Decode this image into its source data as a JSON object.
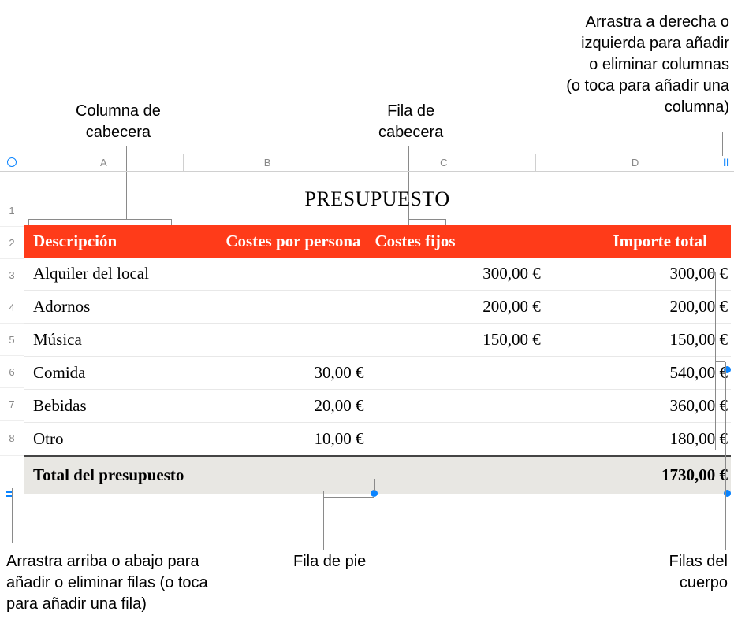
{
  "callouts": {
    "header_col": "Columna de\ncabecera",
    "header_row": "Fila de\ncabecera",
    "add_cols": "Arrastra a derecha o\nizquierda para añadir\no eliminar columnas\n(o toca para añadir una\ncolumna)",
    "add_rows": "Arrastra arriba o abajo para\nañadir o eliminar filas (o toca\npara añadir una fila)",
    "footer_row": "Fila de pie",
    "body_rows": "Filas del\ncuerpo"
  },
  "sheet": {
    "title": "PRESUPUESTO",
    "col_letters": [
      "A",
      "B",
      "C",
      "D"
    ],
    "row_nums": [
      "1",
      "2",
      "3",
      "4",
      "5",
      "6",
      "7",
      "8"
    ],
    "headers": {
      "c1": "Descripción",
      "c2": "Costes por persona",
      "c3": "Costes fijos",
      "c4": "Importe total"
    },
    "rows": [
      {
        "desc": "Alquiler del local",
        "per_person": "",
        "fixed": "300,00 €",
        "total": "300,00 €"
      },
      {
        "desc": "Adornos",
        "per_person": "",
        "fixed": "200,00 €",
        "total": "200,00 €"
      },
      {
        "desc": "Música",
        "per_person": "",
        "fixed": "150,00 €",
        "total": "150,00 €"
      },
      {
        "desc": "Comida",
        "per_person": "30,00 €",
        "fixed": "",
        "total": "540,00 €"
      },
      {
        "desc": "Bebidas",
        "per_person": "20,00 €",
        "fixed": "",
        "total": "360,00 €"
      },
      {
        "desc": "Otro",
        "per_person": "10,00 €",
        "fixed": "",
        "total": "180,00 €"
      }
    ],
    "footer": {
      "label": "Total del presupuesto",
      "total": "1730,00 €"
    }
  }
}
